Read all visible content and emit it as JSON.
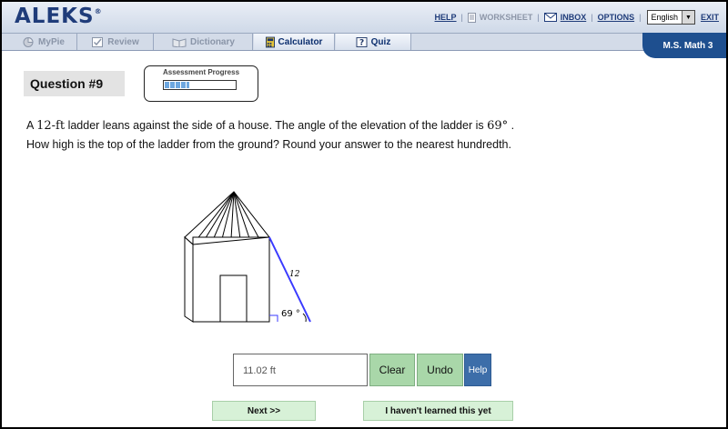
{
  "app": {
    "logo": "ALEKS",
    "logo_mark": "®"
  },
  "toplinks": {
    "help": "HELP",
    "worksheet": "WORKSHEET",
    "inbox": "INBOX",
    "options": "OPTIONS",
    "language": "English",
    "exit": "EXIT"
  },
  "tabs": [
    {
      "label": "MyPie",
      "icon": "pie-chart-icon",
      "active": false
    },
    {
      "label": "Review",
      "icon": "checkmark-icon",
      "active": false
    },
    {
      "label": "Dictionary",
      "icon": "book-icon",
      "active": false
    },
    {
      "label": "Calculator",
      "icon": "calculator-icon",
      "active": true
    },
    {
      "label": "Quiz",
      "icon": "quiz-icon",
      "active": true
    }
  ],
  "course": "M.S. Math 3",
  "question": {
    "number_label": "Question #9",
    "progress_label": "Assessment Progress",
    "progress_fraction": 0.35,
    "text_a": "A ",
    "length_value": "12-ft",
    "text_b": " ladder leans against the side of a house. The angle of the elevation of the ladder is ",
    "angle_value": "69°",
    "text_c": " . How high is the top of the ladder from the ground? Round your answer to the nearest hundredth."
  },
  "figure": {
    "ladder_label": "12",
    "angle_label": "69 °"
  },
  "answer": {
    "value": "11.02 ft"
  },
  "buttons": {
    "clear": "Clear",
    "undo": "Undo",
    "help": "Help",
    "next": "Next >>",
    "not_learned": "I haven't learned this yet"
  },
  "colors": {
    "brand": "#1f3c7a",
    "course_badge": "#1e4f8f",
    "green_button": "#a9d7a9",
    "help_button": "#3d6ea9",
    "ladder": "#3a3aff"
  }
}
